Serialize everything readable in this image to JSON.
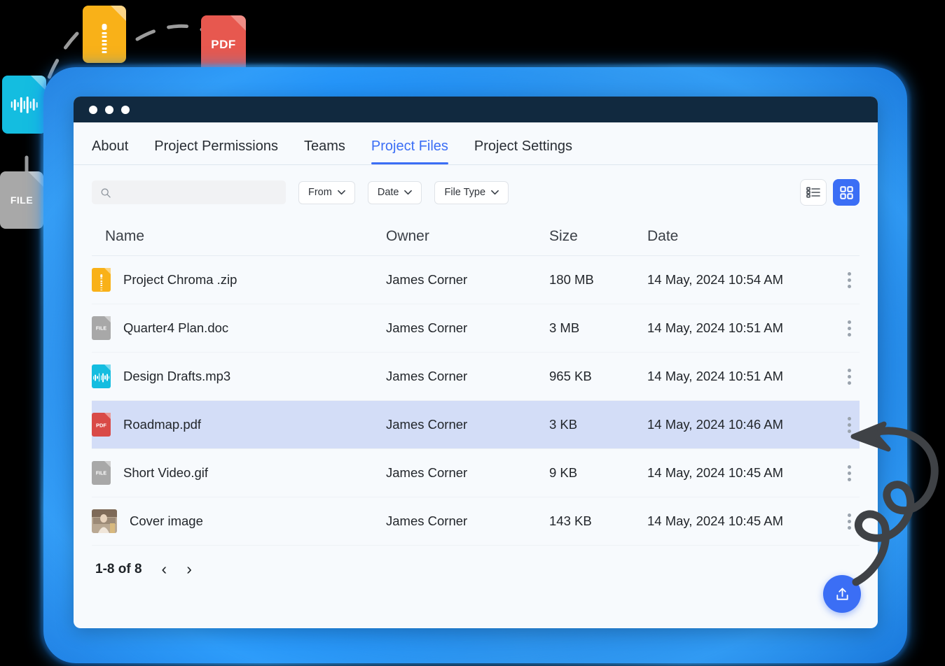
{
  "window": {
    "titlebar_dots": 3,
    "accent_color": "#3b6ef5",
    "titlebar_color": "#11293f"
  },
  "tabs": [
    {
      "label": "About",
      "active": false
    },
    {
      "label": "Project Permissions",
      "active": false
    },
    {
      "label": "Teams",
      "active": false
    },
    {
      "label": "Project Files",
      "active": true
    },
    {
      "label": "Project Settings",
      "active": false
    }
  ],
  "toolbar": {
    "search": {
      "value": "",
      "placeholder": "",
      "icon": "search-icon"
    },
    "filters": [
      {
        "label": "From",
        "icon": "chevron-down-icon"
      },
      {
        "label": "Date",
        "icon": "chevron-down-icon"
      },
      {
        "label": "File Type",
        "icon": "chevron-down-icon"
      }
    ],
    "views": [
      {
        "name": "list-view",
        "icon": "list-icon",
        "active": false
      },
      {
        "name": "grid-view",
        "icon": "grid-icon",
        "active": true
      }
    ]
  },
  "table": {
    "columns": [
      "Name",
      "Owner",
      "Size",
      "Date"
    ],
    "rows": [
      {
        "name": "Project Chroma .zip",
        "owner": "James Corner",
        "size": "180 MB",
        "date": "14 May, 2024 10:54 AM",
        "icon": "zip-file-icon",
        "icon_label": "",
        "icon_color": "#f9b118",
        "selected": false
      },
      {
        "name": "Quarter4 Plan.doc",
        "owner": "James Corner",
        "size": "3 MB",
        "date": "14 May, 2024 10:51 AM",
        "icon": "generic-file-icon",
        "icon_label": "FILE",
        "icon_color": "#a8a8a8",
        "selected": false
      },
      {
        "name": "Design Drafts.mp3",
        "owner": "James Corner",
        "size": "965 KB",
        "date": "14 May, 2024 10:51 AM",
        "icon": "audio-file-icon",
        "icon_label": "",
        "icon_color": "#14bde0",
        "selected": false
      },
      {
        "name": "Roadmap.pdf",
        "owner": "James Corner",
        "size": "3 KB",
        "date": "14 May, 2024 10:46 AM",
        "icon": "pdf-file-icon",
        "icon_label": "PDF",
        "icon_color": "#d94a47",
        "selected": true
      },
      {
        "name": "Short Video.gif",
        "owner": "James Corner",
        "size": "9 KB",
        "date": "14 May, 2024 10:45 AM",
        "icon": "generic-file-icon",
        "icon_label": "FILE",
        "icon_color": "#a8a8a8",
        "selected": false
      },
      {
        "name": "Cover image",
        "owner": "James Corner",
        "size": "143 KB",
        "date": "14 May, 2024 10:45 AM",
        "icon": "image-thumbnail",
        "icon_label": "",
        "icon_color": "#8a7a6d",
        "selected": false
      }
    ],
    "row_menu_icon": "kebab-menu-icon"
  },
  "pagination": {
    "count": "1-8 of 8",
    "prev": "‹",
    "next": "›"
  },
  "fab": {
    "name": "upload-button",
    "icon": "upload-icon"
  },
  "decorations": {
    "floating_files": [
      {
        "name": "floating-zip-file-icon",
        "label": "",
        "color": "#f9b118"
      },
      {
        "name": "floating-pdf-file-icon",
        "label": "PDF",
        "color": "#e7584f"
      },
      {
        "name": "floating-audio-file-icon",
        "label": "",
        "color": "#14bde0"
      },
      {
        "name": "floating-generic-file-icon",
        "label": "FILE",
        "color": "#a8a8a8"
      }
    ],
    "annotation_arrow": "curly-arrow-pointing-to-row-menu"
  }
}
